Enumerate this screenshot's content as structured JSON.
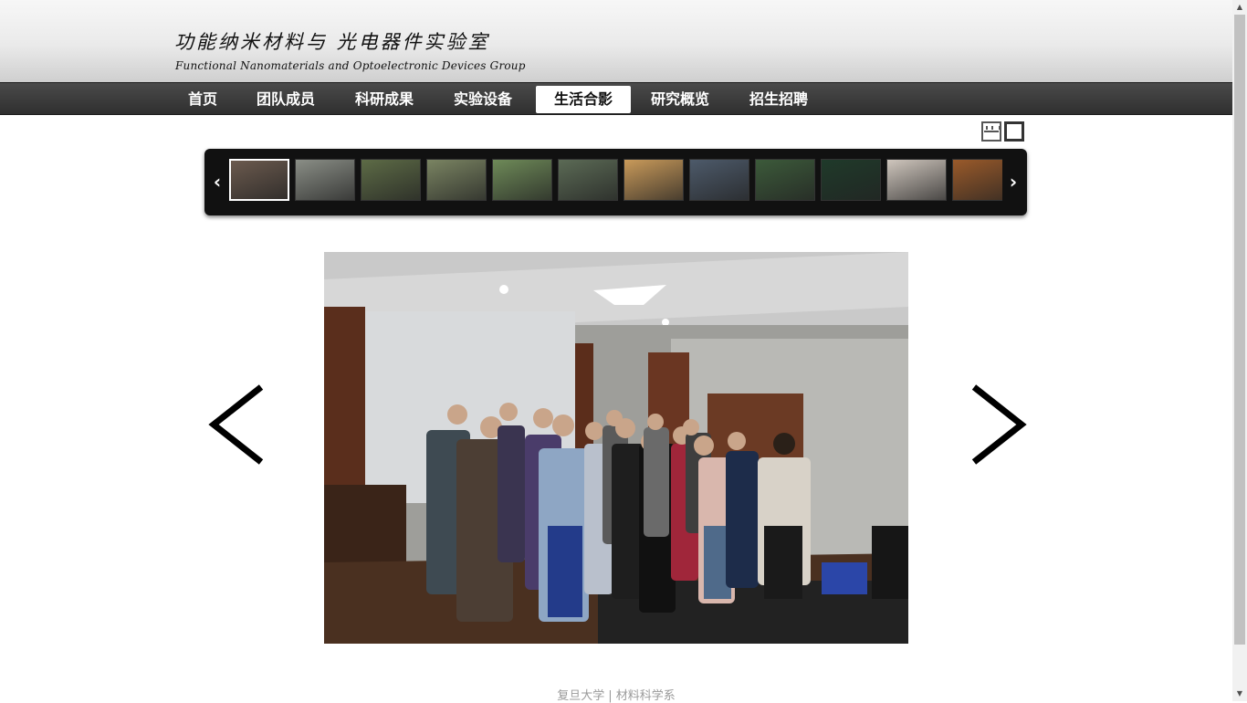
{
  "header": {
    "title_cn": "功能纳米材料与 光电器件实验室",
    "title_en": "Functional Nanomaterials and Optoelectronic Devices Group"
  },
  "nav": {
    "items": [
      {
        "label": "首页",
        "active": false
      },
      {
        "label": "团队成员",
        "active": false
      },
      {
        "label": "科研成果",
        "active": false
      },
      {
        "label": "实验设备",
        "active": false
      },
      {
        "label": "生活合影",
        "active": true
      },
      {
        "label": "研究概览",
        "active": false
      },
      {
        "label": "招生招聘",
        "active": false
      }
    ]
  },
  "gallery": {
    "view_modes": [
      "grid-view-icon",
      "single-view-icon"
    ],
    "strip_prev_glyph": "‹",
    "strip_next_glyph": "›",
    "thumbnails": [
      {
        "subject": "group-photo-indoor",
        "color": "#6b5a4e",
        "active": true
      },
      {
        "subject": "group-photo-stairs",
        "color": "#8a8e86",
        "active": false
      },
      {
        "subject": "group-photo-outdoor",
        "color": "#5d6b46",
        "active": false
      },
      {
        "subject": "group-photo-field",
        "color": "#7a8462",
        "active": false
      },
      {
        "subject": "person-field",
        "color": "#6e8a58",
        "active": false
      },
      {
        "subject": "people-landscape",
        "color": "#5b6a55",
        "active": false
      },
      {
        "subject": "nuts-closeup",
        "color": "#c99a5a",
        "active": false
      },
      {
        "subject": "camera-closeup",
        "color": "#4d5a6a",
        "active": false
      },
      {
        "subject": "lily-pads",
        "color": "#3c5a3a",
        "active": false
      },
      {
        "subject": "clover-leaves",
        "color": "#1f3a2a",
        "active": false
      },
      {
        "subject": "child-portrait",
        "color": "#cfc6bd",
        "active": false
      },
      {
        "subject": "leaf-in-hand",
        "color": "#9a5a2a",
        "active": false
      }
    ]
  },
  "main_photo": {
    "subject": "group-photo-indoor"
  },
  "footer": {
    "university": "复旦大学",
    "separator": "|",
    "department": "材料科学系"
  }
}
